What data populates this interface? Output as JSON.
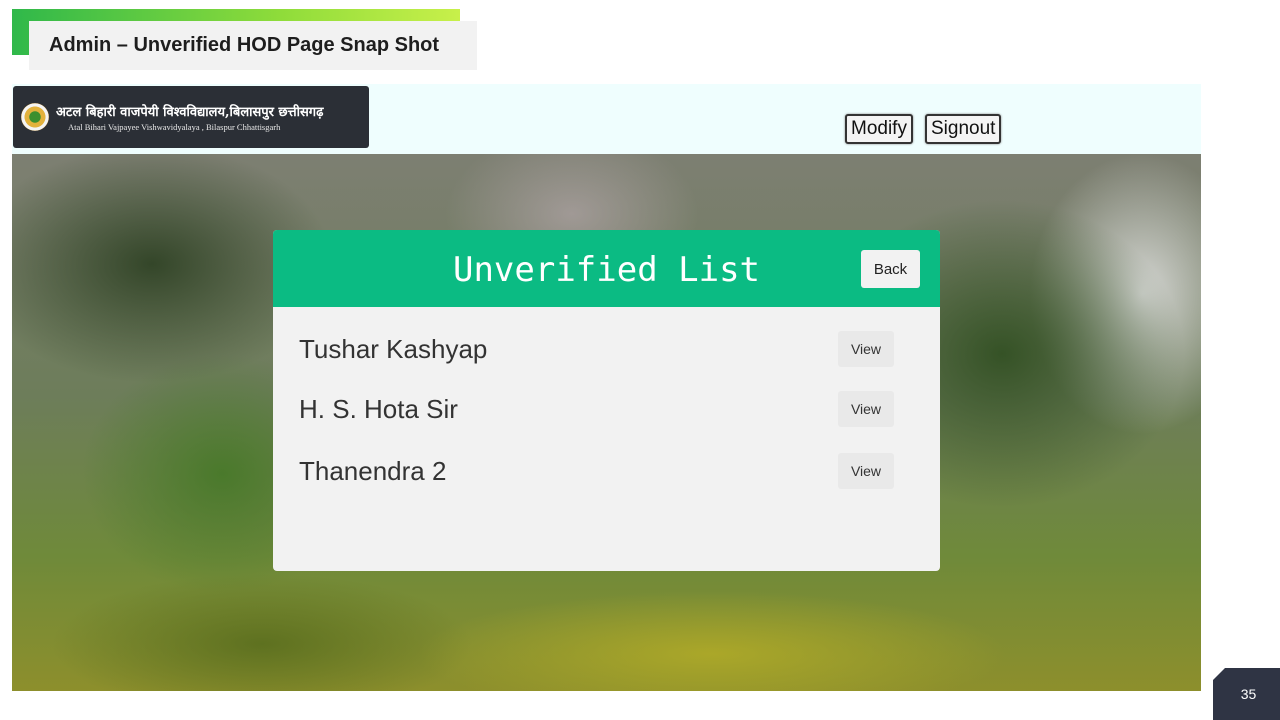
{
  "slide": {
    "title": "Admin – Unverified HOD Page Snap Shot",
    "page_number": "35"
  },
  "header": {
    "logo_hindi": "अटल बिहारी वाजपेयी विश्वविद्यालय,बिलासपुर छत्तीसगढ़",
    "logo_english": "Atal Bihari Vajpayee Vishwavidyalaya , Bilaspur Chhattisgarh",
    "modify_label": "Modify",
    "signout_label": "Signout"
  },
  "card": {
    "title": "Unverified List",
    "back_label": "Back",
    "items": [
      {
        "name": "Tushar Kashyap",
        "action": "View"
      },
      {
        "name": "H. S. Hota Sir",
        "action": "View"
      },
      {
        "name": "Thanendra 2",
        "action": "View"
      }
    ]
  },
  "colors": {
    "accent_green": "#0bbb83",
    "header_bg": "#effefe",
    "card_bg": "#f2f2f2"
  }
}
